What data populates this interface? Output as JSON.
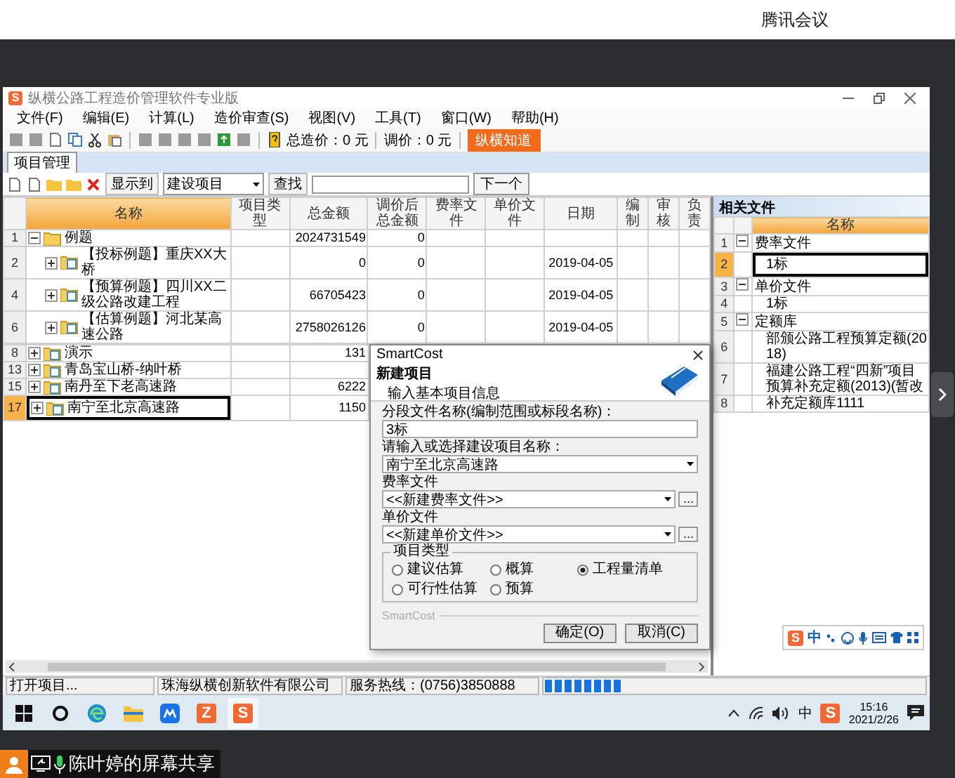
{
  "meeting_bar": {
    "title": "腾讯会议"
  },
  "window": {
    "app_letter": "S",
    "title": "纵横公路工程造价管理软件专业版"
  },
  "menu": [
    "文件(F)",
    "编辑(E)",
    "计算(L)",
    "造价审查(S)",
    "视图(V)",
    "工具(T)",
    "窗口(W)",
    "帮助(H)"
  ],
  "toolbar": {
    "total_cost": "总造价：0 元",
    "adjusted_cost": "调价：0 元",
    "help_button": "纵横知道"
  },
  "tabs": [
    {
      "label": "项目管理",
      "selected": true
    }
  ],
  "project_toolbar": {
    "show_label": "显示到",
    "show_value": "建设项目",
    "find_label": "查找",
    "next_button": "下一个"
  },
  "table": {
    "columns": [
      "名称",
      "项目类型",
      "总金额",
      "调价后总金额",
      "费率文件",
      "单价文件",
      "日期",
      "编制",
      "审核",
      "负责"
    ],
    "rows": [
      {
        "num": "1",
        "kind": "folder",
        "name": "例题",
        "total": "2024731549",
        "adjusted": "0",
        "expanded": true,
        "selected": false,
        "children": [
          {
            "num": "2",
            "kind": "project",
            "name": "【投标例题】重庆XX大桥",
            "total": "0",
            "adjusted": "0",
            "date": "2019-04-05",
            "expanded": false,
            "selected": false
          },
          {
            "num": "4",
            "kind": "project",
            "name": "【预算例题】四川XX二级公路改建工程",
            "total": "66705423",
            "adjusted": "0",
            "date": "2019-04-05",
            "expanded": false,
            "selected": false
          },
          {
            "num": "6",
            "kind": "project",
            "name": "【估算例题】河北某高速公路",
            "total": "2758026126",
            "adjusted": "0",
            "date": "2019-04-05",
            "expanded": false,
            "selected": false
          }
        ]
      },
      {
        "num": "8",
        "kind": "project",
        "name": "演示",
        "total": "131",
        "expanded": false,
        "selected": false
      },
      {
        "num": "13",
        "kind": "project",
        "name": "青岛宝山桥-纳叶桥",
        "expanded": false,
        "selected": false
      },
      {
        "num": "15",
        "kind": "project",
        "name": "南丹至下老高速路",
        "total": "6222",
        "expanded": false,
        "selected": false
      },
      {
        "num": "17",
        "kind": "project",
        "name": "南宁至北京高速路",
        "total": "1150",
        "expanded": false,
        "selected": true
      }
    ]
  },
  "dialog": {
    "title": "SmartCost",
    "heading": "新建项目",
    "subheading": "输入基本项目信息",
    "fields": [
      {
        "kind": "text",
        "label": "分段文件名称(编制范围或标段名称)：",
        "value": "3标"
      },
      {
        "kind": "combo",
        "label": "请输入或选择建设项目名称：",
        "value": "南宁至北京高速路"
      },
      {
        "kind": "browse",
        "label": "费率文件",
        "value": "<<新建费率文件>>",
        "browse_label": "..."
      },
      {
        "kind": "browse",
        "label": "单价文件",
        "value": "<<新建单价文件>>",
        "browse_label": "..."
      }
    ],
    "group_title": "项目类型",
    "options": [
      {
        "label": "建议估算",
        "selected": false
      },
      {
        "label": "概算",
        "selected": false
      },
      {
        "label": "工程量清单",
        "selected": true
      },
      {
        "label": "可行性估算",
        "selected": false
      },
      {
        "label": "预算",
        "selected": false
      }
    ],
    "footer": "SmartCost",
    "buttons": [
      "确定(O)",
      "取消(C)"
    ]
  },
  "related_files": {
    "title": "相关文件",
    "column": "名称",
    "rows": [
      {
        "num": "1",
        "name": "费率文件",
        "expanded": true,
        "selected": false,
        "children": [
          {
            "num": "2",
            "name": "1标",
            "selected": true
          }
        ]
      },
      {
        "num": "3",
        "name": "单价文件",
        "expanded": true,
        "selected": false,
        "children": [
          {
            "num": "4",
            "name": "1标",
            "selected": false
          }
        ]
      },
      {
        "num": "5",
        "name": "定额库",
        "expanded": true,
        "selected": false,
        "children": [
          {
            "num": "6",
            "name": "部颁公路工程预算定额(2018)",
            "selected": false
          },
          {
            "num": "7",
            "name": "福建公路工程“四新”项目预算补充定额(2013)(暂改",
            "selected": false
          },
          {
            "num": "8",
            "name": "补充定额库1111",
            "selected": false
          }
        ]
      }
    ]
  },
  "ime_bar": {
    "logo": "S",
    "mode": "中"
  },
  "status_bar": {
    "texts": [
      "打开项目...",
      "珠海纵横创新软件有限公司",
      "服务热线：(0756)3850888"
    ],
    "progress": {
      "level": 0.2
    }
  },
  "taskbar": {
    "apps": [
      {
        "kind": "start",
        "selected": false
      },
      {
        "kind": "search",
        "selected": false
      },
      {
        "kind": "browser",
        "selected": false
      },
      {
        "kind": "folder",
        "selected": false
      },
      {
        "kind": "meeting",
        "selected": false
      },
      {
        "kind": "letter",
        "letter": "Z",
        "selected": false
      },
      {
        "kind": "letter",
        "letter": "S",
        "selected": true
      }
    ],
    "ime": "中",
    "tray_letter": "S",
    "time": "15:16",
    "date": "2021/2/26"
  },
  "share_label": "陈叶婷的屏幕共享"
}
